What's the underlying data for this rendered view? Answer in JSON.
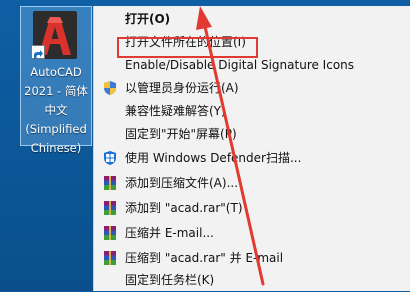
{
  "desktop_icon": {
    "label_lines": [
      "AutoCAD",
      "2021 - 简体",
      "中文",
      "(Simplified",
      "Chinese)"
    ]
  },
  "context_menu": {
    "items": [
      {
        "label": "打开(O)",
        "icon": "none",
        "bold": true
      },
      {
        "label": "打开文件所在的位置(I)",
        "icon": "none",
        "highlighted": true
      },
      {
        "label": "Enable/Disable Digital Signature Icons",
        "icon": "none"
      },
      {
        "label": "以管理员身份运行(A)",
        "icon": "uac-shield-icon"
      },
      {
        "label": "兼容性疑难解答(Y)",
        "icon": "none"
      },
      {
        "label": "固定到\"开始\"屏幕(P)",
        "icon": "none"
      },
      {
        "label": "使用 Windows Defender扫描...",
        "icon": "windows-defender-icon"
      },
      {
        "label": "添加到压缩文件(A)...",
        "icon": "winrar-icon"
      },
      {
        "label": "添加到 \"acad.rar\"(T)",
        "icon": "winrar-icon"
      },
      {
        "label": "压缩并 E-mail...",
        "icon": "winrar-icon"
      },
      {
        "label": "压缩到 \"acad.rar\" 并 E-mail",
        "icon": "winrar-icon"
      },
      {
        "label": "固定到任务栏(K)",
        "icon": "none"
      }
    ]
  },
  "annotation": {
    "highlight_color": "#e13a32",
    "arrow_color": "#e13a32"
  },
  "colors": {
    "desktop": "#0b5696",
    "menu_background": "#f2f2f2",
    "autocad_red": "#d9312b"
  }
}
